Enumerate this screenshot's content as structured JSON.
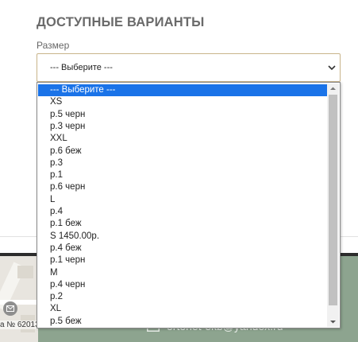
{
  "section": {
    "title": "ДОСТУПНЫЕ ВАРИАНТЫ"
  },
  "size_field": {
    "label": "Размер",
    "selected": "--- Выберите ---"
  },
  "dropdown": {
    "options": [
      "--- Выберите ---",
      "XS",
      "р.5 черн",
      "р.3 черн",
      "XXL",
      "р.6 беж",
      "р.3",
      "р.1",
      "р.6 черн",
      "L",
      "р.4",
      "р.1 беж",
      "S 1450.00р.",
      "р.4 беж",
      "р.1 черн",
      "M",
      "р.4 черн",
      "р.2",
      "XL",
      "р.5 беж"
    ],
    "highlighted_index": 0,
    "scroll_position": 0.05
  },
  "footer": {
    "map_address": "а № 62013",
    "email": "ortonet-ekb@yandex.ru",
    "map_pin_icon": "envelope-icon",
    "email_icon": "envelope-icon"
  },
  "colors": {
    "highlight": "#1a73e8",
    "select_border": "#c9b48a",
    "footer_green": "#8da48f"
  }
}
